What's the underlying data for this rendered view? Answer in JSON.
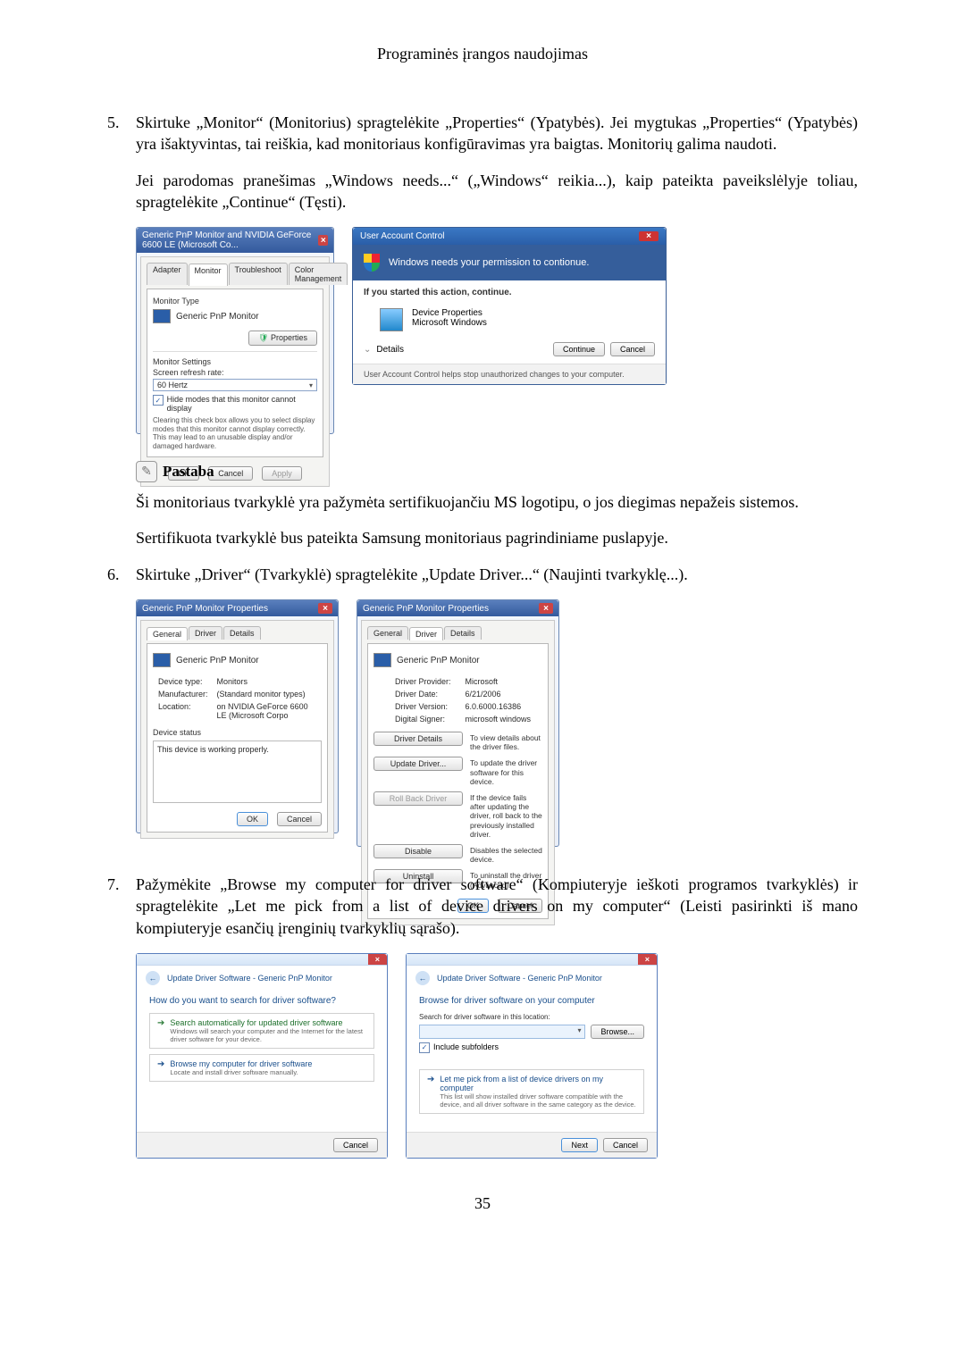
{
  "headerTitle": "Programinės įrangos naudojimas",
  "step5": {
    "num": "5.",
    "text": "Skirtuke „Monitor“ (Monitorius) spragtelėkite „Properties“ (Ypatybės). Jei mygtukas „Properties“ (Ypatybės) yra išaktyvintas, tai reiškia, kad monitoriaus konfigūravimas yra baigtas. Monitorių galima naudoti.",
    "sub": "Jei parodomas pranešimas „Windows needs...“ („Windows“ reikia...), kaip pateikta paveikslėlyje toliau, spragtelėkite „Continue“ (Tęsti)."
  },
  "scr1": {
    "title": "Generic PnP Monitor and NVIDIA GeForce 6600 LE (Microsoft Co...",
    "tabs": [
      "Adapter",
      "Monitor",
      "Troubleshoot",
      "Color Management"
    ],
    "monitorType": "Monitor Type",
    "monitorName": "Generic PnP Monitor",
    "propertiesBtn": "Properties",
    "monitorSettings": "Monitor Settings",
    "refreshLabel": "Screen refresh rate:",
    "refreshVal": "60 Hertz",
    "hideChk": "Hide modes that this monitor cannot display",
    "hideNote": "Clearing this check box allows you to select display modes that this monitor cannot display correctly. This may lead to an unusable display and/or damaged hardware.",
    "ok": "OK",
    "cancel": "Cancel",
    "apply": "Apply"
  },
  "uac": {
    "title": "User Account Control",
    "banner": "Windows needs your permission to contionue.",
    "started": "If you started this action, continue.",
    "progName": "Device Properties",
    "progPub": "Microsoft Windows",
    "details": "Details",
    "continue": "Continue",
    "cancel": "Cancel",
    "foot": "User Account Control helps stop unauthorized changes to your computer."
  },
  "noteLabel": "Pastaba",
  "noteText1": "Ši monitoriaus tvarkyklė yra pažymėta sertifikuojančiu MS logotipu, o jos diegimas nepažeis sistemos.",
  "noteText2": "Sertifikuota tvarkyklė bus pateikta Samsung monitoriaus pagrindiniame puslapyje.",
  "step6": {
    "num": "6.",
    "text": "Skirtuke „Driver“ (Tvarkyklė) spragtelėkite „Update Driver...“ (Naujinti tvarkyklę...)."
  },
  "scr3": {
    "title": "Generic PnP Monitor Properties",
    "tabs": [
      "General",
      "Driver",
      "Details"
    ],
    "name": "Generic PnP Monitor",
    "rows": {
      "deviceType": "Device type:",
      "deviceTypeV": "Monitors",
      "manuf": "Manufacturer:",
      "manufV": "(Standard monitor types)",
      "loc": "Location:",
      "locV": "on NVIDIA GeForce 6600 LE (Microsoft Corpo"
    },
    "deviceStatus": "Device status",
    "statusText": "This device is working properly.",
    "ok": "OK",
    "cancel": "Cancel"
  },
  "scr4": {
    "title": "Generic PnP Monitor Properties",
    "tabs": [
      "General",
      "Driver",
      "Details"
    ],
    "name": "Generic PnP Monitor",
    "rows": {
      "provider": "Driver Provider:",
      "providerV": "Microsoft",
      "date": "Driver Date:",
      "dateV": "6/21/2006",
      "version": "Driver Version:",
      "versionV": "6.0.6000.16386",
      "signer": "Digital Signer:",
      "signerV": "microsoft windows"
    },
    "b1": "Driver Details",
    "d1": "To view details about the driver files.",
    "b2": "Update Driver...",
    "d2": "To update the driver software for this device.",
    "b3": "Roll Back Driver",
    "d3": "If the device fails after updating the driver, roll back to the previously installed driver.",
    "b4": "Disable",
    "d4": "Disables the selected device.",
    "b5": "Uninstall",
    "d5": "To uninstall the driver (Advanced).",
    "ok": "OK",
    "cancel": "Cancel"
  },
  "step7": {
    "num": "7.",
    "text": "Pažymėkite „Browse my computer for driver software“ (Kompiuteryje ieškoti programos tvarkyklės) ir spragtelėkite „Let me pick from a list of device drivers on my computer“ (Leisti pasirinkti iš mano kompiuteryje esančių įrenginių tvarkyklių sąrašo)."
  },
  "wiz1": {
    "bread": "Update Driver Software - Generic PnP Monitor",
    "h": "How do you want to search for driver software?",
    "o1t": "Search automatically for updated driver software",
    "o1d": "Windows will search your computer and the Internet for the latest driver software for your device.",
    "o2t": "Browse my computer for driver software",
    "o2d": "Locate and install driver software manually.",
    "cancel": "Cancel"
  },
  "wiz2": {
    "bread": "Update Driver Software - Generic PnP Monitor",
    "h": "Browse for driver software on your computer",
    "searchLbl": "Search for driver software in this location:",
    "browse": "Browse...",
    "include": "Include subfolders",
    "o1t": "Let me pick from a list of device drivers on my computer",
    "o1d": "This list will show installed driver software compatible with the device, and all driver software in the same category as the device.",
    "next": "Next",
    "cancel": "Cancel"
  },
  "pageNum": "35"
}
